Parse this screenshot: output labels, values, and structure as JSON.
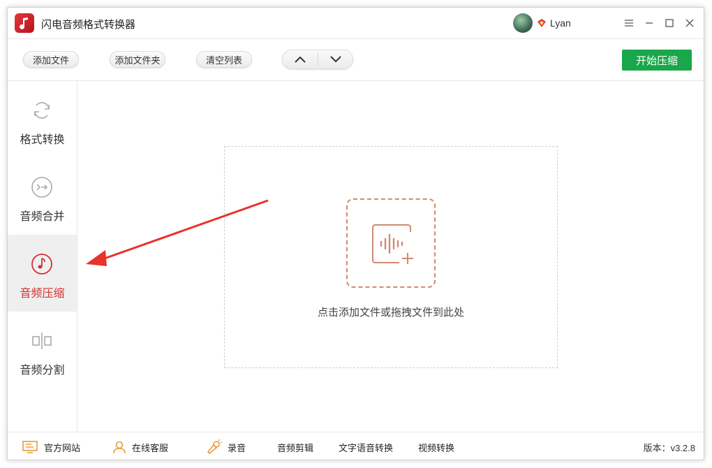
{
  "app": {
    "title": "闪电音频格式转换器",
    "user_name": "Lyan"
  },
  "window_controls": {
    "menu_icon": "hamburger-icon",
    "minimize_icon": "minimize-icon",
    "maximize_icon": "maximize-icon",
    "close_icon": "close-icon"
  },
  "toolbar": {
    "add_file": "添加文件",
    "add_folder": "添加文件夹",
    "clear_list": "清空列表",
    "move_up_icon": "chevron-up-icon",
    "move_down_icon": "chevron-down-icon",
    "start_label": "开始压缩",
    "start_color": "#1aa64a"
  },
  "sidebar": {
    "items": [
      {
        "label": "格式转换",
        "icon": "refresh-cycle-icon",
        "active": false
      },
      {
        "label": "音频合并",
        "icon": "merge-arrow-icon",
        "active": false
      },
      {
        "label": "音频压缩",
        "icon": "music-note-icon",
        "active": true
      },
      {
        "label": "音频分割",
        "icon": "split-icon",
        "active": false
      }
    ],
    "active_color": "#d43030"
  },
  "main": {
    "drop_text": "点击添加文件或拖拽文件到此处",
    "drop_icon": "audio-wave-add-icon"
  },
  "bottom": {
    "official_site": "官方网站",
    "online_service": "在线客服",
    "record": "录音",
    "audio_cut": "音频剪辑",
    "tts": "文字语音转换",
    "video_convert": "视频转换",
    "version": "版本：v3.2.8"
  }
}
